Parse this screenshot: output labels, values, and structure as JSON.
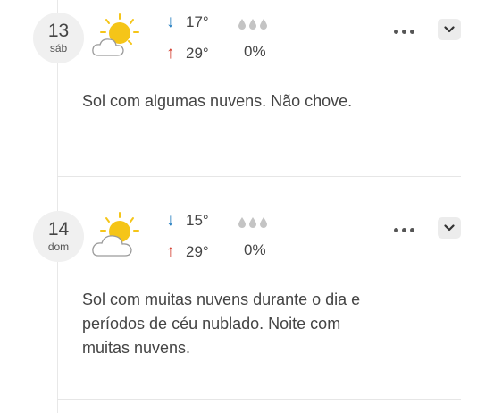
{
  "days": [
    {
      "day_number": "13",
      "weekday": "sáb",
      "weather_icon": "sun-with-cloud-icon",
      "temp_min": "17°",
      "temp_max": "29°",
      "rain_icon": "rain-drops-icon",
      "rain_probability": "0%",
      "description": "Sol com algumas nuvens. Não chove."
    },
    {
      "day_number": "14",
      "weekday": "dom",
      "weather_icon": "sun-with-cloud-icon",
      "temp_min": "15°",
      "temp_max": "29°",
      "rain_icon": "rain-drops-icon",
      "rain_probability": "0%",
      "description": "Sol com muitas nuvens durante o dia e períodos de céu nublado. Noite com muitas nuvens."
    }
  ],
  "colors": {
    "temp_min_arrow": "#1f7bbf",
    "temp_max_arrow": "#d23a2b",
    "sun": "#f5c518",
    "date_circle_bg": "#f0f0f0"
  }
}
